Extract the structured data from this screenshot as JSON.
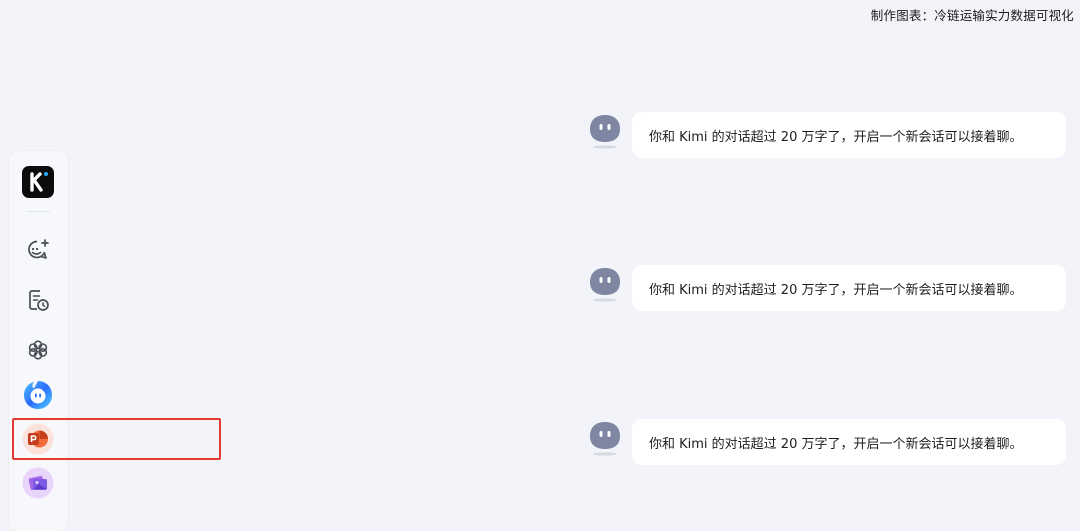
{
  "caption": "制作图表：冷链运输实力数据可视化",
  "sidebar": {
    "logo_icon": "kimi-logo-icon",
    "items": [
      {
        "icon": "new-chat-icon"
      },
      {
        "icon": "history-icon"
      },
      {
        "icon": "explore-icon"
      },
      {
        "icon": "kimi-assistant-icon"
      },
      {
        "icon": "ppt-assistant-icon"
      },
      {
        "icon": "image-assistant-icon"
      }
    ]
  },
  "messages": [
    {
      "avatar": "kimi-bot-avatar",
      "text": "你和 Kimi 的对话超过 20 万字了，开启一个新会话可以接着聊。"
    },
    {
      "avatar": "kimi-bot-avatar",
      "text": "你和 Kimi 的对话超过 20 万字了，开启一个新会话可以接着聊。"
    },
    {
      "avatar": "kimi-bot-avatar",
      "text": "你和 Kimi 的对话超过 20 万字了，开启一个新会话可以接着聊。"
    }
  ],
  "colors": {
    "background": "#f3f4f9",
    "highlight": "#e53935",
    "bubble": "#ffffff"
  }
}
